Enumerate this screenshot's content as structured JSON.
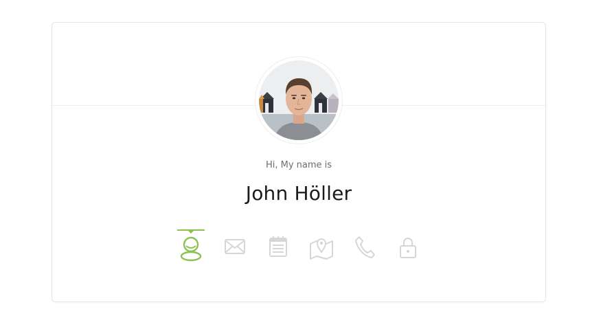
{
  "profile": {
    "greeting": "Hi, My name is",
    "name": "John Höller",
    "avatar_alt": "profile photo"
  },
  "icons": [
    {
      "name": "user-icon",
      "active": true
    },
    {
      "name": "email-icon",
      "active": false
    },
    {
      "name": "calendar-icon",
      "active": false
    },
    {
      "name": "map-icon",
      "active": false
    },
    {
      "name": "phone-icon",
      "active": false
    },
    {
      "name": "lock-icon",
      "active": false
    }
  ],
  "colors": {
    "active": "#8cc152",
    "inactive": "#d6d6d6",
    "name_text": "#1a1a1a",
    "greeting_text": "#6d6d6d"
  }
}
